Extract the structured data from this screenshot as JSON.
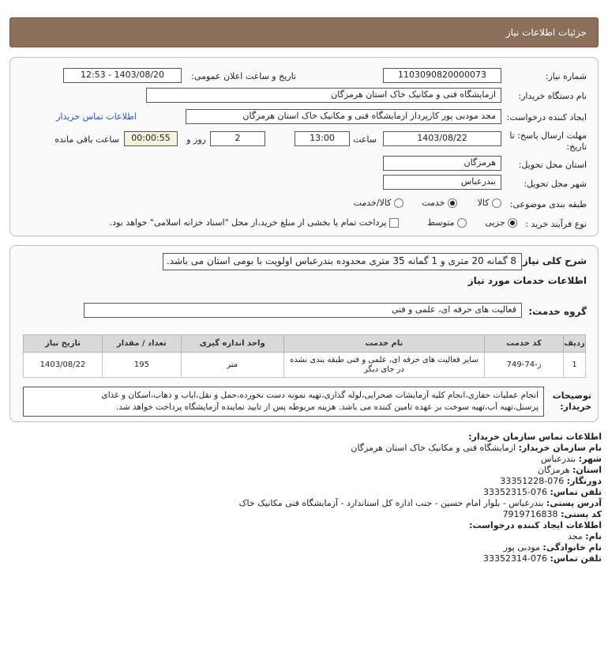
{
  "header": {
    "title": "جزئیات اطلاعات نیاز"
  },
  "form": {
    "need_number_label": "شماره نیاز:",
    "need_number": "1103090820000073",
    "announce_label": "تاریخ و ساعت اعلان عمومی:",
    "announce_value": "1403/08/20 - 12:53",
    "buyer_org_label": "نام دستگاه خریدار:",
    "buyer_org": "ازمایشگاه فنی و مکانیک خاک استان هرمزگان",
    "creator_label": "ایجاد کننده درخواست:",
    "creator": "مجد  مودبی پور کارپرداز ازمایشگاه فنی و مکانیک خاک استان هرمزگان",
    "contact_link": "اطلاعات تماس خریدار",
    "deadline_label_1": "مهلت ارسال پاسخ: تا",
    "deadline_label_2": "تاریخ:",
    "deadline_date": "1403/08/22",
    "time_label": "ساعت",
    "deadline_time": "13:00",
    "days": "2",
    "days_label": "روز و",
    "remaining": "00:00:55",
    "remaining_label": "ساعت باقی مانده",
    "province_label": "استان محل تحویل:",
    "province": "هرمزگان",
    "city_label": "شهر محل تحویل:",
    "city": "بندرعباس",
    "category_label": "طبقه بندی موضوعی:",
    "category_options": [
      "کالا",
      "خدمت",
      "کالا/خدمت"
    ],
    "category_selected": 1,
    "process_label": "نوع فرآیند خرید :",
    "process_options": [
      "جزیی",
      "متوسط"
    ],
    "process_selected": 0,
    "payment_note": "پرداخت تمام یا بخشی از مبلغ خرید،از محل \"اسناد خزانه اسلامی\" خواهد بود."
  },
  "details": {
    "summary_label": "شرح کلی نیاز:",
    "summary": "8 گمانه 20 متری و 1 گمانه 35 متری محدوده بندرعباس اولویت با بومی استان می باشد.",
    "services_title": "اطلاعات خدمات مورد نیاز",
    "group_label": "گروه خدمت:",
    "group": "فعالیت های حرفه ای، علمی و فنی",
    "table": {
      "headers": [
        "ردیف",
        "کد خدمت",
        "نام خدمت",
        "واحد اندازه گیری",
        "تعداد / مقدار",
        "تاریخ نیاز"
      ],
      "rows": [
        [
          "1",
          "ز-74-749",
          "سایر فعالیت های حرفه ای، علمی و فنی طبقه بندی نشده در جای دیگر",
          "متر",
          "195",
          "1403/08/22"
        ]
      ]
    },
    "buyer_notes_label_1": "توضیحات",
    "buyer_notes_label_2": "خریدار:",
    "buyer_notes_line1": "انجام عملیات حفاری،انجام کلیه آزمایشات صحرایی،لوله گذاری،تهیه نمونه دست نخورده،حمل و نقل،ایاب و ذهاب،اسکان و غذای",
    "buyer_notes_line2": "پرسنل،تهیه آب،تهیه سوخت بر عهده تامین کننده می باشد. هزینه مربوطه پس از تایید نماینده آزمایشگاه پرداخت خواهد شد."
  },
  "contact": {
    "org_section": "اطلاعات تماس سازمان خریدار:",
    "buyer_name_k": "نام سازمان خریدار:",
    "buyer_name_v": "ازمایشگاه فنی و مکانیک خاک استان هرمزگان",
    "city_k": "شهر:",
    "city_v": "بندرعباس",
    "province_k": "استان:",
    "province_v": "هرمزگان",
    "fax_k": "دورنگار:",
    "fax_v": "076-33351228",
    "phone_k": "تلفن تماس:",
    "phone_v": "076-33352315",
    "address_k": "آدرس پستی:",
    "address_v": "بندرعباس - بلوار امام حسین - جنب اداره کل استاندارد - آزمایشگاه فنی مکانیک خاک",
    "postal_k": "کد پستی:",
    "postal_v": "7919716838",
    "creator_section": "اطلاعات ایجاد کننده درخواست:",
    "first_k": "نام:",
    "first_v": "مجد",
    "last_k": "نام خانوادگی:",
    "last_v": "مودبی پور",
    "cphone_k": "تلفن تماس:",
    "cphone_v": "076-33352314"
  }
}
